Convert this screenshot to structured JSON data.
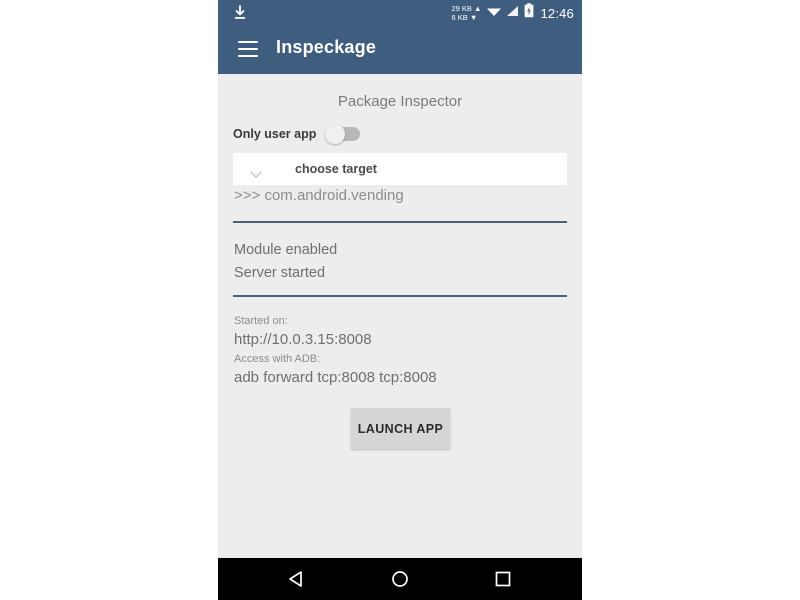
{
  "statusbar": {
    "download_icon": "download-icon",
    "net_up": "29 KB",
    "net_down": "6 KB",
    "up_arrow": "▲",
    "down_arrow": "▼",
    "wifi_icon": "wifi-icon",
    "signal_icon": "signal-icon",
    "battery_icon": "battery-icon",
    "time": "12:46"
  },
  "appbar": {
    "menu_icon": "hamburger-menu-icon",
    "title": "Inspeckage"
  },
  "main": {
    "page_title": "Package Inspector",
    "toggle": {
      "label": "Only user app",
      "state": "off"
    },
    "spinner": {
      "chevron_icon": "chevron-down-icon",
      "selected": "choose target"
    },
    "target_line": ">>> com.android.vending",
    "status": {
      "line1": "Module enabled",
      "line2": "Server started"
    },
    "server_info": {
      "started_on_label": "Started on:",
      "url": "http://10.0.3.15:8008",
      "adb_label": "Access with ADB:",
      "adb_command": "adb forward tcp:8008 tcp:8008"
    },
    "launch_button": "LAUNCH APP"
  },
  "navbar": {
    "back_icon": "back-triangle-icon",
    "home_icon": "home-circle-icon",
    "recents_icon": "recents-square-icon"
  },
  "colors": {
    "appbar": "#3f5d7e",
    "content_bg": "#ededed",
    "divider": "#47617e",
    "button": "#d6d6d6",
    "navbar": "#000000"
  }
}
